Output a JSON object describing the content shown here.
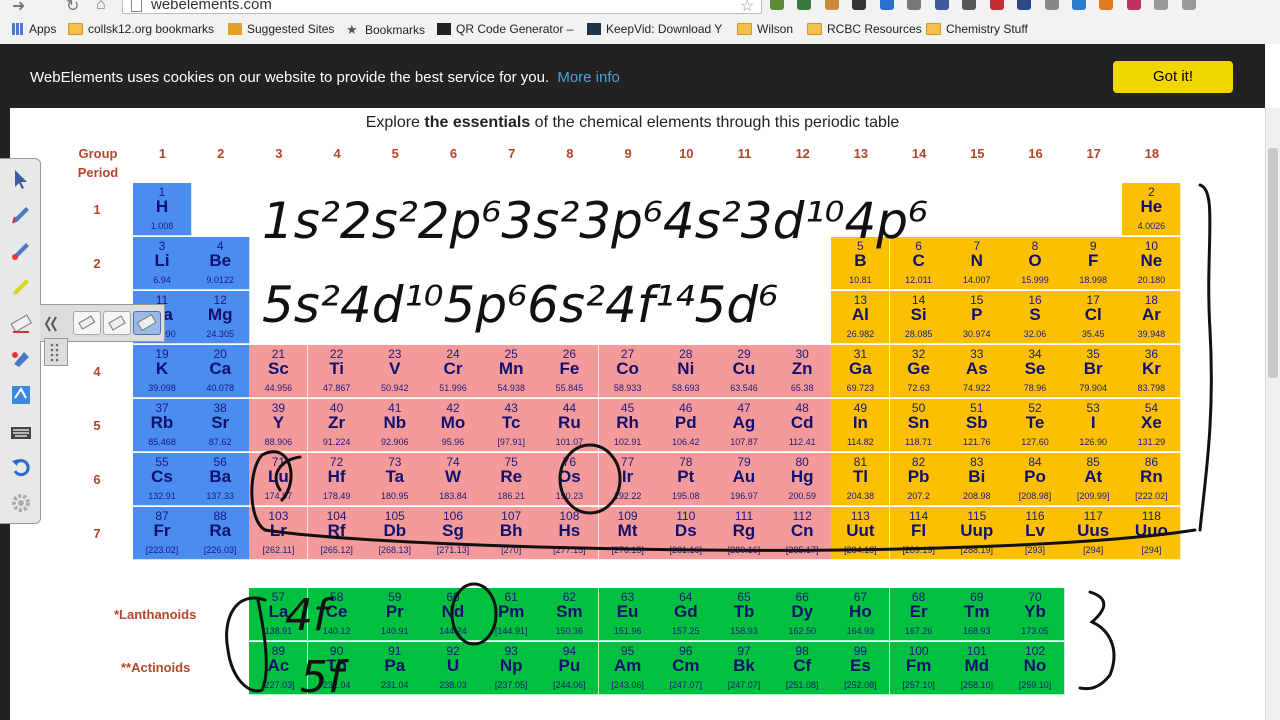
{
  "browser": {
    "url": "webelements.com",
    "bookmarks": [
      "Apps",
      "collsk12.org bookmarks",
      "Suggested Sites",
      "Bookmarks",
      "QR Code Generator –",
      "KeepVid: Download Y",
      "Wilson",
      "RCBC Resources",
      "Chemistry Stuff"
    ]
  },
  "cookie": {
    "text": "WebElements uses cookies on our website to provide the best service for you.",
    "link": "More info",
    "button": "Got it!"
  },
  "intro": {
    "pre": "Explore ",
    "bold": "the essentials",
    "post": " of the chemical elements through this periodic table"
  },
  "headers": {
    "group": "Group",
    "period": "Period",
    "groups": [
      "1",
      "2",
      "3",
      "4",
      "5",
      "6",
      "7",
      "8",
      "9",
      "10",
      "11",
      "12",
      "13",
      "14",
      "15",
      "16",
      "17",
      "18"
    ],
    "periods": [
      "1",
      "2",
      "3",
      "4",
      "5",
      "6",
      "7"
    ]
  },
  "series_labels": {
    "lanthanoids": "*Lanthanoids",
    "actinoids": "**Actinoids",
    "act_marker": "**"
  },
  "colors": {
    "s_block": "#4a8cf0",
    "d_block": "#f59a9a",
    "p_block": "#fcc000",
    "f_block": "#00c040",
    "header_text": "#b5462a",
    "cookie_bg": "#222222",
    "cookie_button": "#f1d600"
  },
  "elements": [
    {
      "n": "1",
      "s": "H",
      "m": "1.008",
      "g": 1,
      "p": 1,
      "c": "s"
    },
    {
      "n": "2",
      "s": "He",
      "m": "4.0026",
      "g": 18,
      "p": 1,
      "c": "he"
    },
    {
      "n": "3",
      "s": "Li",
      "m": "6.94",
      "g": 1,
      "p": 2,
      "c": "s"
    },
    {
      "n": "4",
      "s": "Be",
      "m": "9.0122",
      "g": 2,
      "p": 2,
      "c": "s"
    },
    {
      "n": "5",
      "s": "B",
      "m": "10.81",
      "g": 13,
      "p": 2,
      "c": "p"
    },
    {
      "n": "6",
      "s": "C",
      "m": "12.011",
      "g": 14,
      "p": 2,
      "c": "p"
    },
    {
      "n": "7",
      "s": "N",
      "m": "14.007",
      "g": 15,
      "p": 2,
      "c": "p"
    },
    {
      "n": "8",
      "s": "O",
      "m": "15.999",
      "g": 16,
      "p": 2,
      "c": "p"
    },
    {
      "n": "9",
      "s": "F",
      "m": "18.998",
      "g": 17,
      "p": 2,
      "c": "p"
    },
    {
      "n": "10",
      "s": "Ne",
      "m": "20.180",
      "g": 18,
      "p": 2,
      "c": "p"
    },
    {
      "n": "11",
      "s": "Na",
      "m": "22.990",
      "g": 1,
      "p": 3,
      "c": "s"
    },
    {
      "n": "12",
      "s": "Mg",
      "m": "24.305",
      "g": 2,
      "p": 3,
      "c": "s"
    },
    {
      "n": "13",
      "s": "Al",
      "m": "26.982",
      "g": 13,
      "p": 3,
      "c": "p"
    },
    {
      "n": "14",
      "s": "Si",
      "m": "28.085",
      "g": 14,
      "p": 3,
      "c": "p"
    },
    {
      "n": "15",
      "s": "P",
      "m": "30.974",
      "g": 15,
      "p": 3,
      "c": "p"
    },
    {
      "n": "16",
      "s": "S",
      "m": "32.06",
      "g": 16,
      "p": 3,
      "c": "p"
    },
    {
      "n": "17",
      "s": "Cl",
      "m": "35.45",
      "g": 17,
      "p": 3,
      "c": "p"
    },
    {
      "n": "18",
      "s": "Ar",
      "m": "39.948",
      "g": 18,
      "p": 3,
      "c": "p"
    },
    {
      "n": "19",
      "s": "K",
      "m": "39.098",
      "g": 1,
      "p": 4,
      "c": "s"
    },
    {
      "n": "20",
      "s": "Ca",
      "m": "40.078",
      "g": 2,
      "p": 4,
      "c": "s"
    },
    {
      "n": "21",
      "s": "Sc",
      "m": "44.956",
      "g": 3,
      "p": 4,
      "c": "d"
    },
    {
      "n": "22",
      "s": "Ti",
      "m": "47.867",
      "g": 4,
      "p": 4,
      "c": "d"
    },
    {
      "n": "23",
      "s": "V",
      "m": "50.942",
      "g": 5,
      "p": 4,
      "c": "d"
    },
    {
      "n": "24",
      "s": "Cr",
      "m": "51.996",
      "g": 6,
      "p": 4,
      "c": "d"
    },
    {
      "n": "25",
      "s": "Mn",
      "m": "54.938",
      "g": 7,
      "p": 4,
      "c": "d"
    },
    {
      "n": "26",
      "s": "Fe",
      "m": "55.845",
      "g": 8,
      "p": 4,
      "c": "d"
    },
    {
      "n": "27",
      "s": "Co",
      "m": "58.933",
      "g": 9,
      "p": 4,
      "c": "d"
    },
    {
      "n": "28",
      "s": "Ni",
      "m": "58.693",
      "g": 10,
      "p": 4,
      "c": "d"
    },
    {
      "n": "29",
      "s": "Cu",
      "m": "63.546",
      "g": 11,
      "p": 4,
      "c": "d"
    },
    {
      "n": "30",
      "s": "Zn",
      "m": "65.38",
      "g": 12,
      "p": 4,
      "c": "d"
    },
    {
      "n": "31",
      "s": "Ga",
      "m": "69.723",
      "g": 13,
      "p": 4,
      "c": "p"
    },
    {
      "n": "32",
      "s": "Ge",
      "m": "72.63",
      "g": 14,
      "p": 4,
      "c": "p"
    },
    {
      "n": "33",
      "s": "As",
      "m": "74.922",
      "g": 15,
      "p": 4,
      "c": "p"
    },
    {
      "n": "34",
      "s": "Se",
      "m": "78.96",
      "g": 16,
      "p": 4,
      "c": "p"
    },
    {
      "n": "35",
      "s": "Br",
      "m": "79.904",
      "g": 17,
      "p": 4,
      "c": "p"
    },
    {
      "n": "36",
      "s": "Kr",
      "m": "83.798",
      "g": 18,
      "p": 4,
      "c": "p"
    },
    {
      "n": "37",
      "s": "Rb",
      "m": "85.468",
      "g": 1,
      "p": 5,
      "c": "s"
    },
    {
      "n": "38",
      "s": "Sr",
      "m": "87.62",
      "g": 2,
      "p": 5,
      "c": "s"
    },
    {
      "n": "39",
      "s": "Y",
      "m": "88.906",
      "g": 3,
      "p": 5,
      "c": "d"
    },
    {
      "n": "40",
      "s": "Zr",
      "m": "91.224",
      "g": 4,
      "p": 5,
      "c": "d"
    },
    {
      "n": "41",
      "s": "Nb",
      "m": "92.906",
      "g": 5,
      "p": 5,
      "c": "d"
    },
    {
      "n": "42",
      "s": "Mo",
      "m": "95.96",
      "g": 6,
      "p": 5,
      "c": "d"
    },
    {
      "n": "43",
      "s": "Tc",
      "m": "[97.91]",
      "g": 7,
      "p": 5,
      "c": "d"
    },
    {
      "n": "44",
      "s": "Ru",
      "m": "101.07",
      "g": 8,
      "p": 5,
      "c": "d"
    },
    {
      "n": "45",
      "s": "Rh",
      "m": "102.91",
      "g": 9,
      "p": 5,
      "c": "d"
    },
    {
      "n": "46",
      "s": "Pd",
      "m": "106.42",
      "g": 10,
      "p": 5,
      "c": "d"
    },
    {
      "n": "47",
      "s": "Ag",
      "m": "107.87",
      "g": 11,
      "p": 5,
      "c": "d"
    },
    {
      "n": "48",
      "s": "Cd",
      "m": "112.41",
      "g": 12,
      "p": 5,
      "c": "d"
    },
    {
      "n": "49",
      "s": "In",
      "m": "114.82",
      "g": 13,
      "p": 5,
      "c": "p"
    },
    {
      "n": "50",
      "s": "Sn",
      "m": "118.71",
      "g": 14,
      "p": 5,
      "c": "p"
    },
    {
      "n": "51",
      "s": "Sb",
      "m": "121.76",
      "g": 15,
      "p": 5,
      "c": "p"
    },
    {
      "n": "52",
      "s": "Te",
      "m": "127.60",
      "g": 16,
      "p": 5,
      "c": "p"
    },
    {
      "n": "53",
      "s": "I",
      "m": "126.90",
      "g": 17,
      "p": 5,
      "c": "p"
    },
    {
      "n": "54",
      "s": "Xe",
      "m": "131.29",
      "g": 18,
      "p": 5,
      "c": "p"
    },
    {
      "n": "55",
      "s": "Cs",
      "m": "132.91",
      "g": 1,
      "p": 6,
      "c": "s"
    },
    {
      "n": "56",
      "s": "Ba",
      "m": "137.33",
      "g": 2,
      "p": 6,
      "c": "s"
    },
    {
      "n": "71",
      "s": "Lu",
      "m": "174.97",
      "g": 3,
      "p": 6,
      "c": "d"
    },
    {
      "n": "72",
      "s": "Hf",
      "m": "178.49",
      "g": 4,
      "p": 6,
      "c": "d"
    },
    {
      "n": "73",
      "s": "Ta",
      "m": "180.95",
      "g": 5,
      "p": 6,
      "c": "d"
    },
    {
      "n": "74",
      "s": "W",
      "m": "183.84",
      "g": 6,
      "p": 6,
      "c": "d"
    },
    {
      "n": "75",
      "s": "Re",
      "m": "186.21",
      "g": 7,
      "p": 6,
      "c": "d"
    },
    {
      "n": "76",
      "s": "Os",
      "m": "190.23",
      "g": 8,
      "p": 6,
      "c": "d"
    },
    {
      "n": "77",
      "s": "Ir",
      "m": "192.22",
      "g": 9,
      "p": 6,
      "c": "d"
    },
    {
      "n": "78",
      "s": "Pt",
      "m": "195.08",
      "g": 10,
      "p": 6,
      "c": "d"
    },
    {
      "n": "79",
      "s": "Au",
      "m": "196.97",
      "g": 11,
      "p": 6,
      "c": "d"
    },
    {
      "n": "80",
      "s": "Hg",
      "m": "200.59",
      "g": 12,
      "p": 6,
      "c": "d"
    },
    {
      "n": "81",
      "s": "Tl",
      "m": "204.38",
      "g": 13,
      "p": 6,
      "c": "p"
    },
    {
      "n": "82",
      "s": "Pb",
      "m": "207.2",
      "g": 14,
      "p": 6,
      "c": "p"
    },
    {
      "n": "83",
      "s": "Bi",
      "m": "208.98",
      "g": 15,
      "p": 6,
      "c": "p"
    },
    {
      "n": "84",
      "s": "Po",
      "m": "[208.98]",
      "g": 16,
      "p": 6,
      "c": "p"
    },
    {
      "n": "85",
      "s": "At",
      "m": "[209.99]",
      "g": 17,
      "p": 6,
      "c": "p"
    },
    {
      "n": "86",
      "s": "Rn",
      "m": "[222.02]",
      "g": 18,
      "p": 6,
      "c": "p"
    },
    {
      "n": "87",
      "s": "Fr",
      "m": "[223.02]",
      "g": 1,
      "p": 7,
      "c": "s"
    },
    {
      "n": "88",
      "s": "Ra",
      "m": "[226.03]",
      "g": 2,
      "p": 7,
      "c": "s"
    },
    {
      "n": "103",
      "s": "Lr",
      "m": "[262.11]",
      "g": 3,
      "p": 7,
      "c": "d"
    },
    {
      "n": "104",
      "s": "Rf",
      "m": "[265.12]",
      "g": 4,
      "p": 7,
      "c": "d"
    },
    {
      "n": "105",
      "s": "Db",
      "m": "[268.13]",
      "g": 5,
      "p": 7,
      "c": "d"
    },
    {
      "n": "106",
      "s": "Sg",
      "m": "[271.13]",
      "g": 6,
      "p": 7,
      "c": "d"
    },
    {
      "n": "107",
      "s": "Bh",
      "m": "[270]",
      "g": 7,
      "p": 7,
      "c": "d"
    },
    {
      "n": "108",
      "s": "Hs",
      "m": "[277.15]",
      "g": 8,
      "p": 7,
      "c": "d"
    },
    {
      "n": "109",
      "s": "Mt",
      "m": "[276.15]",
      "g": 9,
      "p": 7,
      "c": "d"
    },
    {
      "n": "110",
      "s": "Ds",
      "m": "[281.16]",
      "g": 10,
      "p": 7,
      "c": "d"
    },
    {
      "n": "111",
      "s": "Rg",
      "m": "[280.16]",
      "g": 11,
      "p": 7,
      "c": "d"
    },
    {
      "n": "112",
      "s": "Cn",
      "m": "[285.17]",
      "g": 12,
      "p": 7,
      "c": "d"
    },
    {
      "n": "113",
      "s": "Uut",
      "m": "[284.18]",
      "g": 13,
      "p": 7,
      "c": "p"
    },
    {
      "n": "114",
      "s": "Fl",
      "m": "[289.19]",
      "g": 14,
      "p": 7,
      "c": "p"
    },
    {
      "n": "115",
      "s": "Uup",
      "m": "[288.19]",
      "g": 15,
      "p": 7,
      "c": "p"
    },
    {
      "n": "116",
      "s": "Lv",
      "m": "[293]",
      "g": 16,
      "p": 7,
      "c": "p"
    },
    {
      "n": "117",
      "s": "Uus",
      "m": "[294]",
      "g": 17,
      "p": 7,
      "c": "p"
    },
    {
      "n": "118",
      "s": "Uuo",
      "m": "[294]",
      "g": 18,
      "p": 7,
      "c": "p"
    },
    {
      "n": "57",
      "s": "La",
      "m": "138.91",
      "g": 3,
      "p": 8,
      "c": "f"
    },
    {
      "n": "58",
      "s": "Ce",
      "m": "140.12",
      "g": 4,
      "p": 8,
      "c": "f"
    },
    {
      "n": "59",
      "s": "Pr",
      "m": "140.91",
      "g": 5,
      "p": 8,
      "c": "f"
    },
    {
      "n": "60",
      "s": "Nd",
      "m": "144.24",
      "g": 6,
      "p": 8,
      "c": "f"
    },
    {
      "n": "61",
      "s": "Pm",
      "m": "[144.91]",
      "g": 7,
      "p": 8,
      "c": "f"
    },
    {
      "n": "62",
      "s": "Sm",
      "m": "150.36",
      "g": 8,
      "p": 8,
      "c": "f"
    },
    {
      "n": "63",
      "s": "Eu",
      "m": "151.96",
      "g": 9,
      "p": 8,
      "c": "f"
    },
    {
      "n": "64",
      "s": "Gd",
      "m": "157.25",
      "g": 10,
      "p": 8,
      "c": "f"
    },
    {
      "n": "65",
      "s": "Tb",
      "m": "158.93",
      "g": 11,
      "p": 8,
      "c": "f"
    },
    {
      "n": "66",
      "s": "Dy",
      "m": "162.50",
      "g": 12,
      "p": 8,
      "c": "f"
    },
    {
      "n": "67",
      "s": "Ho",
      "m": "164.93",
      "g": 13,
      "p": 8,
      "c": "f"
    },
    {
      "n": "68",
      "s": "Er",
      "m": "167.26",
      "g": 14,
      "p": 8,
      "c": "f"
    },
    {
      "n": "69",
      "s": "Tm",
      "m": "168.93",
      "g": 15,
      "p": 8,
      "c": "f"
    },
    {
      "n": "70",
      "s": "Yb",
      "m": "173.05",
      "g": 16,
      "p": 8,
      "c": "f"
    },
    {
      "n": "89",
      "s": "Ac",
      "m": "[227.03]",
      "g": 3,
      "p": 9,
      "c": "f"
    },
    {
      "n": "90",
      "s": "Th",
      "m": "232.04",
      "g": 4,
      "p": 9,
      "c": "f"
    },
    {
      "n": "91",
      "s": "Pa",
      "m": "231.04",
      "g": 5,
      "p": 9,
      "c": "f"
    },
    {
      "n": "92",
      "s": "U",
      "m": "238.03",
      "g": 6,
      "p": 9,
      "c": "f"
    },
    {
      "n": "93",
      "s": "Np",
      "m": "[237.05]",
      "g": 7,
      "p": 9,
      "c": "f"
    },
    {
      "n": "94",
      "s": "Pu",
      "m": "[244.06]",
      "g": 8,
      "p": 9,
      "c": "f"
    },
    {
      "n": "95",
      "s": "Am",
      "m": "[243.06]",
      "g": 9,
      "p": 9,
      "c": "f"
    },
    {
      "n": "96",
      "s": "Cm",
      "m": "[247.07]",
      "g": 10,
      "p": 9,
      "c": "f"
    },
    {
      "n": "97",
      "s": "Bk",
      "m": "[247.07]",
      "g": 11,
      "p": 9,
      "c": "f"
    },
    {
      "n": "98",
      "s": "Cf",
      "m": "[251.08]",
      "g": 12,
      "p": 9,
      "c": "f"
    },
    {
      "n": "99",
      "s": "Es",
      "m": "[252.08]",
      "g": 13,
      "p": 9,
      "c": "f"
    },
    {
      "n": "100",
      "s": "Fm",
      "m": "[257.10]",
      "g": 14,
      "p": 9,
      "c": "f"
    },
    {
      "n": "101",
      "s": "Md",
      "m": "[258.10]",
      "g": 15,
      "p": 9,
      "c": "f"
    },
    {
      "n": "102",
      "s": "No",
      "m": "[259.10]",
      "g": 16,
      "p": 9,
      "c": "f"
    }
  ],
  "annotation": {
    "line1": "1s²2s²2p⁶3s²3p⁶4s²3d¹⁰4p⁶",
    "line2": "5s²4d¹⁰5p⁶6s²4f¹⁴5d⁶",
    "side1": "4f",
    "side2": "5f"
  },
  "toolbar_tools": [
    "select-arrow-icon",
    "pen-icon",
    "highlighter-pen-icon",
    "highlighter-icon",
    "eraser-icon",
    "fill-icon",
    "note-icon",
    "keyboard-icon",
    "undo-icon",
    "settings-icon"
  ]
}
